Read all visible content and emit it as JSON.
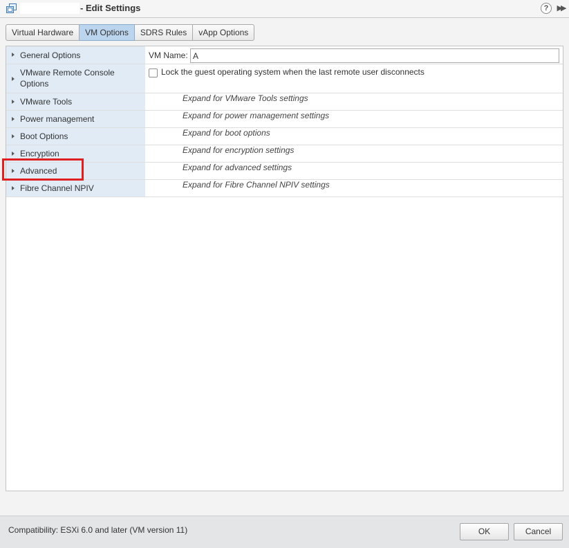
{
  "window": {
    "title_suffix": "- Edit Settings",
    "help_glyph": "?",
    "expand_glyph": "▶▶"
  },
  "tabs": [
    {
      "label": "Virtual Hardware",
      "active": false
    },
    {
      "label": "VM Options",
      "active": true
    },
    {
      "label": "SDRS Rules",
      "active": false
    },
    {
      "label": "vApp Options",
      "active": false
    }
  ],
  "options": {
    "general": {
      "label": "General Options",
      "vm_name_label": "VM Name:",
      "vm_name_value": "A"
    },
    "remote_console": {
      "label": "VMware Remote Console Options",
      "lock_text": "Lock the guest operating system when the last remote user disconnects",
      "lock_checked": false
    },
    "vmware_tools": {
      "label": "VMware Tools",
      "hint": "Expand for VMware Tools settings"
    },
    "power": {
      "label": "Power management",
      "hint": "Expand for power management settings"
    },
    "boot": {
      "label": "Boot Options",
      "hint": "Expand for boot options"
    },
    "encryption": {
      "label": "Encryption",
      "hint": "Expand for encryption settings"
    },
    "advanced": {
      "label": "Advanced",
      "hint": "Expand for advanced settings"
    },
    "fibre": {
      "label": "Fibre Channel NPIV",
      "hint": "Expand for Fibre Channel NPIV settings"
    }
  },
  "footer": {
    "compatibility": "Compatibility: ESXi 6.0 and later (VM version 11)",
    "ok_label": "OK",
    "cancel_label": "Cancel"
  },
  "colors": {
    "active_tab": "#bcd5ef",
    "label_column": "#e0ebf5",
    "highlight": "#e02020"
  },
  "icons": {
    "window": "vm-icon",
    "help": "help-icon",
    "expand": "double-chevron-right-icon",
    "row_expander": "caret-right-icon"
  }
}
